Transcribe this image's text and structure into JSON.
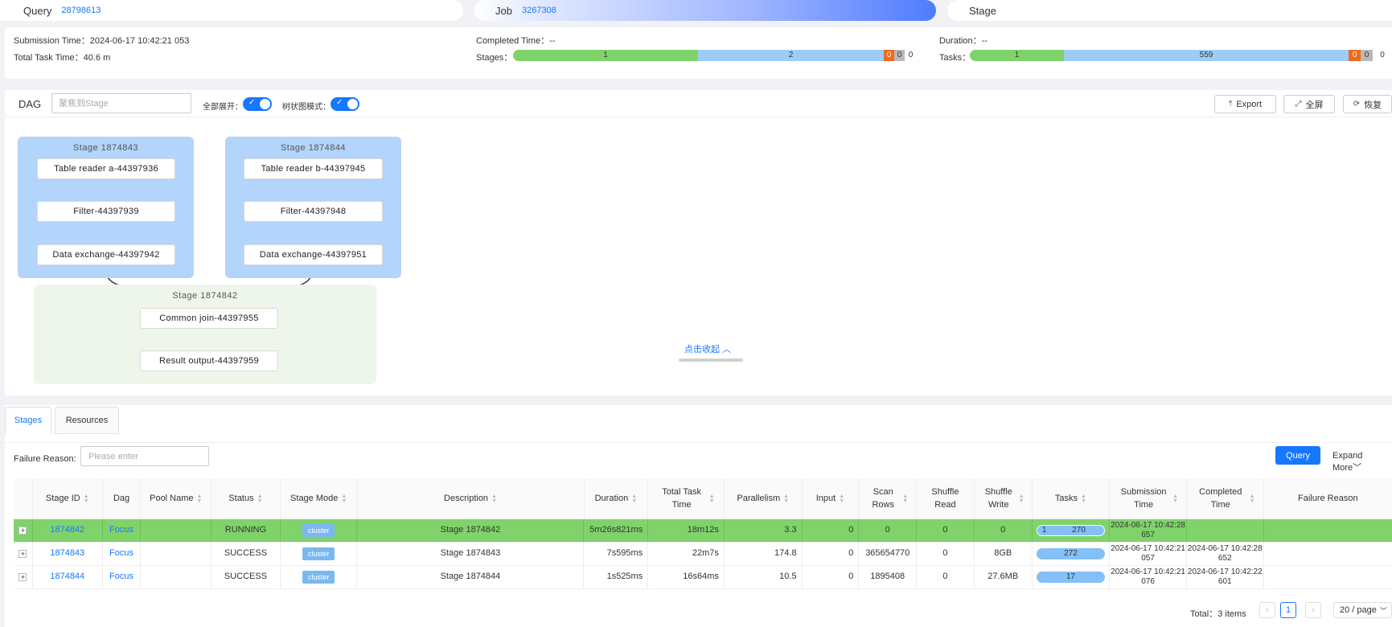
{
  "breadcrumb": {
    "query_label": "Query",
    "query_id": "28798613",
    "job_label": "Job",
    "job_id": "3267308",
    "stage_label": "Stage"
  },
  "summary": {
    "submission_time_label": "Submission Time：",
    "submission_time": "2024-06-17 10:42:21 053",
    "total_task_time_label": "Total Task Time：",
    "total_task_time": "40.6 m",
    "completed_time_label": "Completed Time：",
    "completed_time": "--",
    "duration_label": "Duration：",
    "duration": "--",
    "stages_label": "Stages：",
    "stages": {
      "succeeded": "1",
      "running": "2",
      "failed": "0",
      "killed": "0",
      "other": "0",
      "succeeded_fraction": 0.333,
      "running_fraction": 0.667
    },
    "tasks_label": "Tasks：",
    "tasks": {
      "succeeded": "1",
      "running": "559",
      "failed": "0",
      "killed": "0",
      "other": "0"
    }
  },
  "dag": {
    "title": "DAG",
    "search_placeholder": "聚焦到Stage",
    "expand_all_label": "全部展开：",
    "tree_mode_label": "树状图模式：",
    "expand_all_on": true,
    "tree_mode_on": true,
    "export_label": "Export",
    "fullscreen_label": "全屏",
    "restore_label": "恢复",
    "collapse_link": "点击收起",
    "stages": [
      {
        "title": "Stage 1874843",
        "nodes": [
          "Table reader a-44397936",
          "Filter-44397939",
          "Data exchange-44397942"
        ]
      },
      {
        "title": "Stage 1874844",
        "nodes": [
          "Table reader b-44397945",
          "Filter-44397948",
          "Data exchange-44397951"
        ]
      },
      {
        "title": "Stage 1874842",
        "nodes": [
          "Common join-44397955",
          "Result output-44397959"
        ]
      }
    ],
    "colors": {
      "stage_blue": "#b3d4fb",
      "stage_green": "#eef5ea",
      "edge": "#444444"
    }
  },
  "tabs": [
    "Stages",
    "Resources"
  ],
  "filter": {
    "failure_reason_label": "Failure Reason:",
    "failure_reason_placeholder": "Please enter",
    "query_button": "Query",
    "expand_more": "Expand More"
  },
  "table": {
    "headers": [
      "Stage ID",
      "Dag",
      "Pool Name",
      "Status",
      "Stage Mode",
      "Description",
      "Duration",
      "Total Task Time",
      "Parallelism",
      "Input",
      "Scan Rows",
      "Shuffle Read",
      "Shuffle Write",
      "Tasks",
      "Submission Time",
      "Completed Time",
      "Failure Reason"
    ],
    "rows": [
      {
        "stage_id": "1874842",
        "dag": "Focus",
        "pool": "",
        "status": "RUNNING",
        "mode": "cluster",
        "description": "Stage 1874842",
        "duration": "5m26s821ms",
        "total_task_time": "18m12s",
        "parallelism": "3.3",
        "input": "0",
        "scan_rows": "0",
        "shuffle_read": "0",
        "shuffle_write": "0",
        "tasks_done": "1",
        "tasks_total": "270",
        "submission": "2024-06-17 10:42:28 657",
        "completed": "",
        "failure": ""
      },
      {
        "stage_id": "1874843",
        "dag": "Focus",
        "pool": "",
        "status": "SUCCESS",
        "mode": "cluster",
        "description": "Stage 1874843",
        "duration": "7s595ms",
        "total_task_time": "22m7s",
        "parallelism": "174.8",
        "input": "0",
        "scan_rows": "365654770",
        "shuffle_read": "0",
        "shuffle_write": "8GB",
        "tasks_done": "",
        "tasks_total": "272",
        "submission": "2024-06-17 10:42:21 057",
        "completed": "2024-06-17 10:42:28 652",
        "failure": ""
      },
      {
        "stage_id": "1874844",
        "dag": "Focus",
        "pool": "",
        "status": "SUCCESS",
        "mode": "cluster",
        "description": "Stage 1874844",
        "duration": "1s525ms",
        "total_task_time": "16s64ms",
        "parallelism": "10.5",
        "input": "0",
        "scan_rows": "1895408",
        "shuffle_read": "0",
        "shuffle_write": "27.6MB",
        "tasks_done": "",
        "tasks_total": "17",
        "submission": "2024-06-17 10:42:21 076",
        "completed": "2024-06-17 10:42:22 601",
        "failure": ""
      }
    ]
  },
  "pagination": {
    "total": "Total：3 items",
    "current_page": "1",
    "page_size": "20 / page"
  }
}
